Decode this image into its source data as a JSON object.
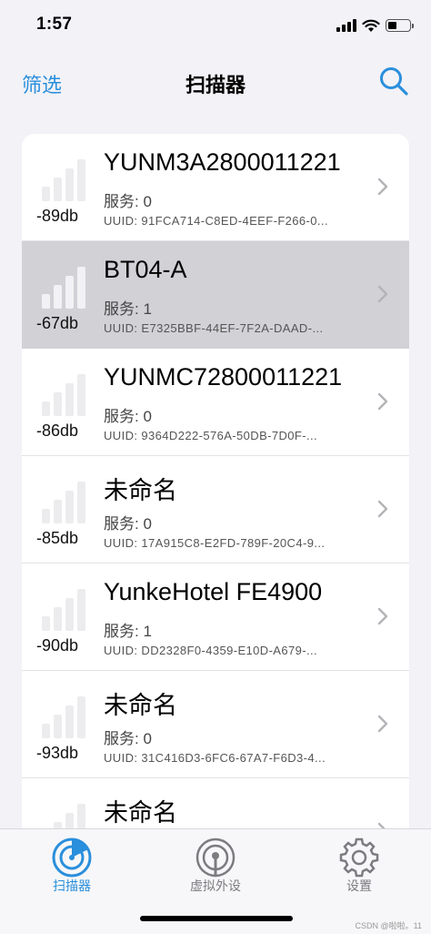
{
  "status_bar": {
    "time": "1:57"
  },
  "nav": {
    "left_label": "筛选",
    "title": "扫描器",
    "search_icon": "search-icon",
    "accent_color": "#2a8fdc"
  },
  "devices": [
    {
      "rssi": "-89db",
      "name": "YUNM3A2800011221",
      "services": "服务: 0",
      "uuid": "UUID: 91FCA714-C8ED-4EEF-F266-0...",
      "signal_level": 0,
      "selected": false
    },
    {
      "rssi": "-67db",
      "name": "BT04-A",
      "services": "服务: 1",
      "uuid": "UUID: E7325BBF-44EF-7F2A-DAAD-...",
      "signal_level": 2,
      "selected": true
    },
    {
      "rssi": "-86db",
      "name": "YUNMC72800011221",
      "services": "服务: 0",
      "uuid": "UUID: 9364D222-576A-50DB-7D0F-...",
      "signal_level": 0,
      "selected": false
    },
    {
      "rssi": "-85db",
      "name": "未命名",
      "services": "服务: 0",
      "uuid": "UUID: 17A915C8-E2FD-789F-20C4-9...",
      "signal_level": 0,
      "selected": false
    },
    {
      "rssi": "-90db",
      "name": "YunkeHotel FE4900",
      "services": "服务: 1",
      "uuid": "UUID: DD2328F0-4359-E10D-A679-...",
      "signal_level": 0,
      "selected": false
    },
    {
      "rssi": "-93db",
      "name": "未命名",
      "services": "服务: 0",
      "uuid": "UUID: 31C416D3-6FC6-67A7-F6D3-4...",
      "signal_level": 0,
      "selected": false
    },
    {
      "rssi": "",
      "name": "未命名",
      "services": "",
      "uuid": "",
      "signal_level": 0,
      "selected": false
    }
  ],
  "tabs": [
    {
      "label": "扫描器",
      "icon": "radar-icon",
      "active": true
    },
    {
      "label": "虚拟外设",
      "icon": "broadcast-icon",
      "active": false
    },
    {
      "label": "设置",
      "icon": "gear-icon",
      "active": false
    }
  ],
  "watermark": "CSDN @啦啦。11"
}
